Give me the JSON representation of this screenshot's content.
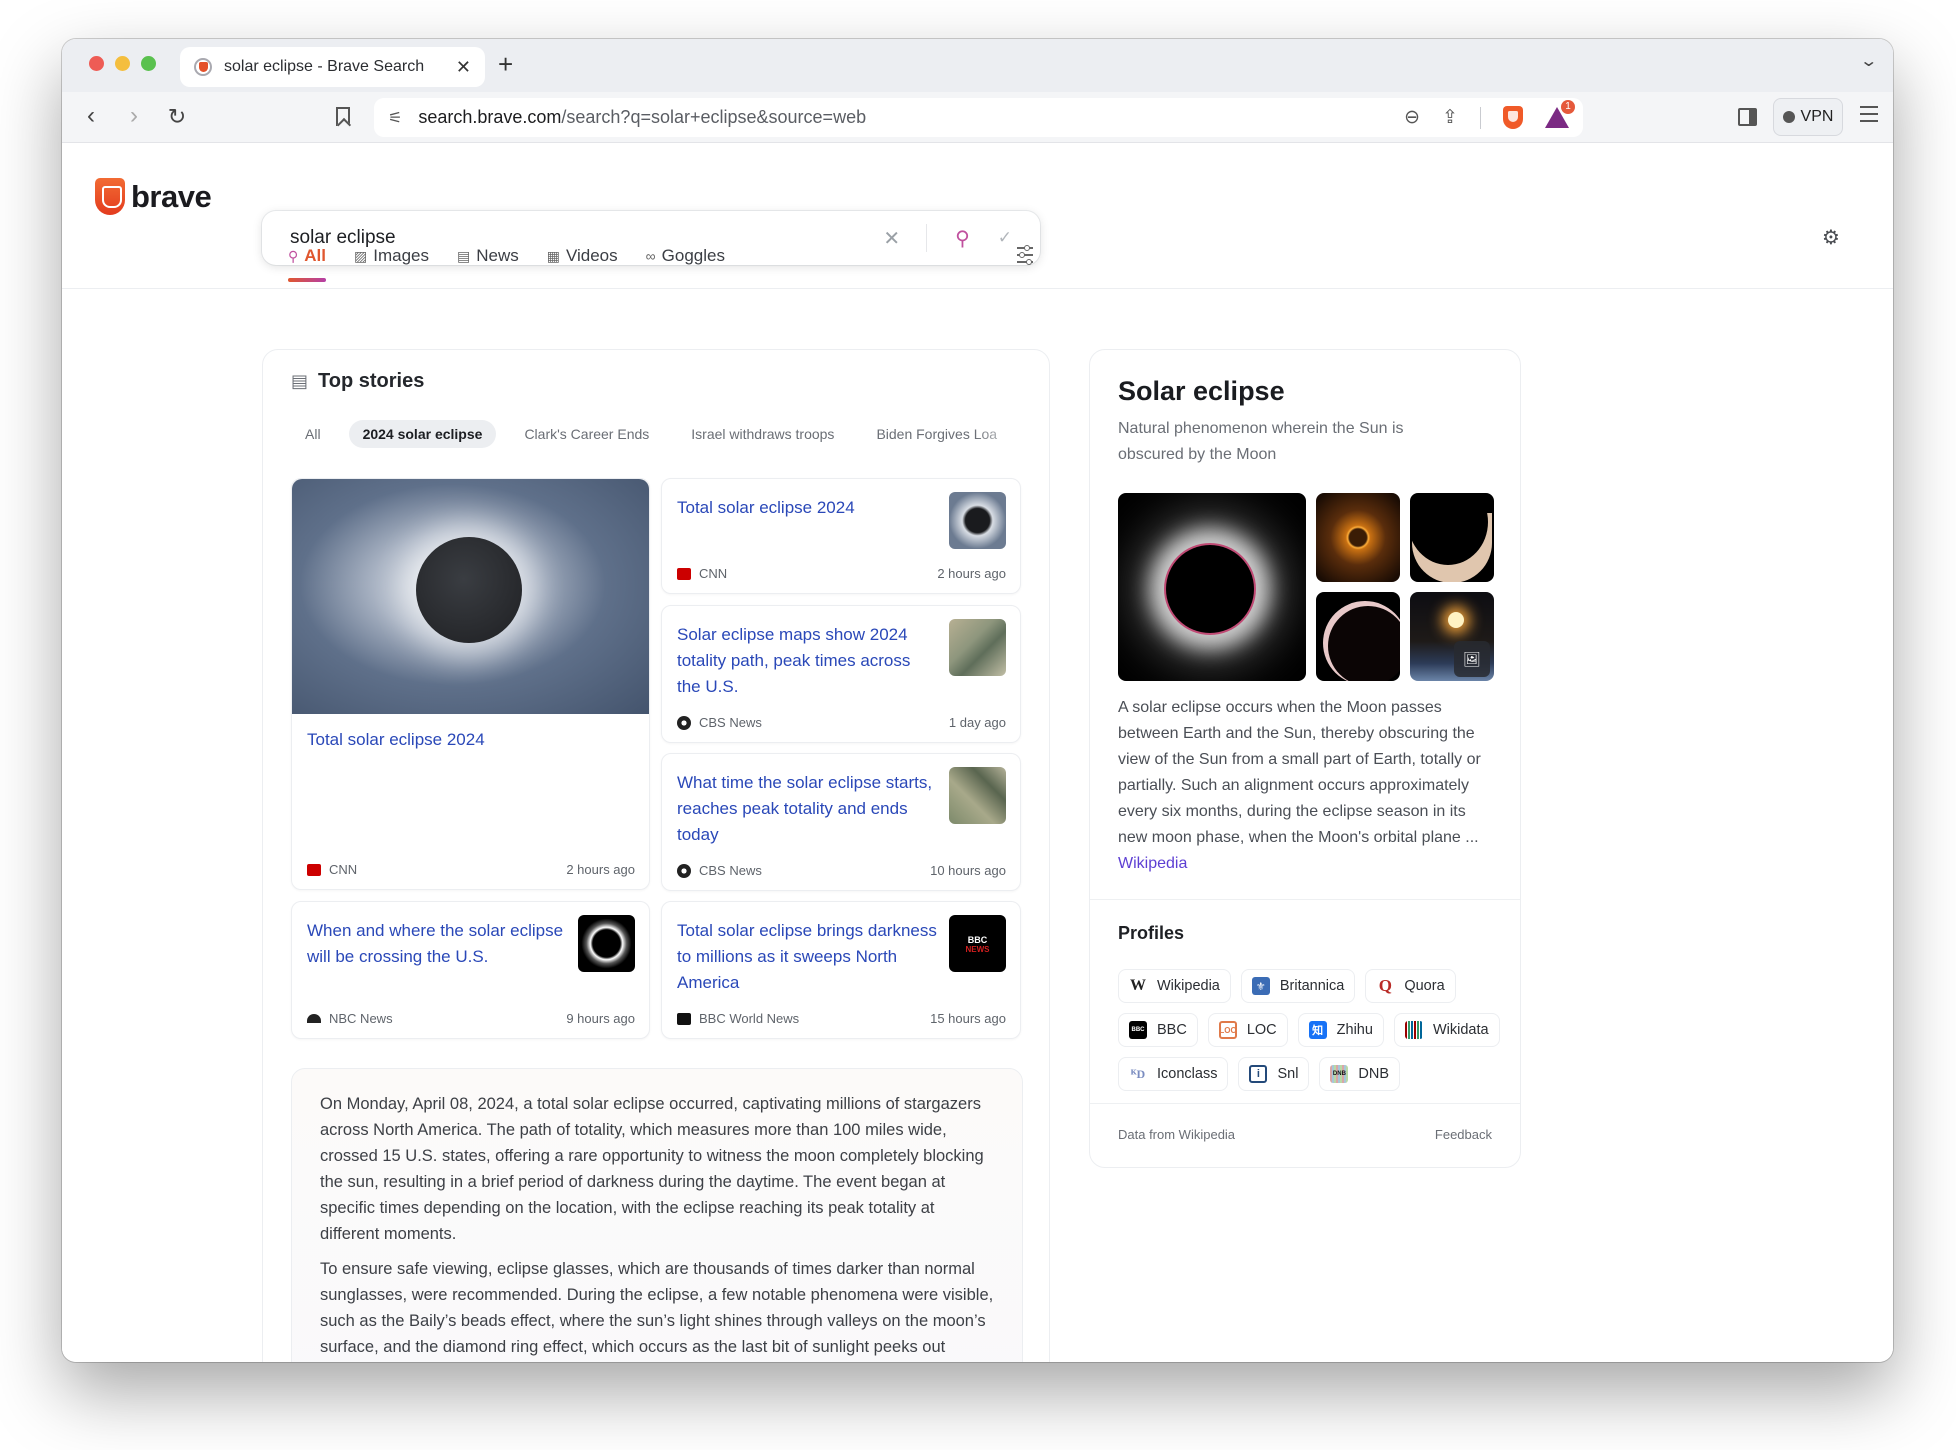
{
  "browser": {
    "tab_title": "solar eclipse - Brave Search",
    "tab_close": "✕",
    "new_tab": "+",
    "tab_menu": "⌄",
    "url_host": "search.brave.com",
    "url_rest": "/search?q=solar+eclipse&source=web",
    "vpn_label": "VPN",
    "rewards_badge": "1"
  },
  "search": {
    "logo_text": "brave",
    "query": "solar eclipse",
    "clear_icon": "✕",
    "search_icon": "⚲",
    "check_icon": "✓",
    "settings_icon": "⚙"
  },
  "nav_tabs": [
    {
      "label": "All",
      "icon": "⚲",
      "active": true
    },
    {
      "label": "Images",
      "icon": "▨"
    },
    {
      "label": "News",
      "icon": "▤"
    },
    {
      "label": "Videos",
      "icon": "▦"
    },
    {
      "label": "Goggles",
      "icon": "∞"
    }
  ],
  "top_stories": {
    "title": "Top stories",
    "chips": [
      "All",
      "2024 solar eclipse",
      "Clark's Career Ends",
      "Israel withdraws troops",
      "Biden Forgives Loa"
    ],
    "active_chip": "2024 solar eclipse",
    "featured": {
      "headline": "Total solar eclipse 2024",
      "source": "CNN",
      "time": "2 hours ago"
    },
    "cards": [
      {
        "headline": "Total solar eclipse 2024",
        "source": "CNN",
        "time": "2 hours ago"
      },
      {
        "headline": "Solar eclipse maps show 2024 totality path, peak times across the U.S.",
        "source": "CBS News",
        "time": "1 day ago"
      },
      {
        "headline": "What time the solar eclipse starts, reaches peak totality and ends today",
        "source": "CBS News",
        "time": "10 hours ago"
      },
      {
        "headline": "When and where the solar eclipse will be crossing the U.S.",
        "source": "NBC News",
        "time": "9 hours ago"
      },
      {
        "headline": "Total solar eclipse brings darkness to millions as it sweeps North America",
        "source": "BBC World News",
        "time": "15 hours ago",
        "thumb_text": "BBC",
        "thumb_sub": "NEWS"
      }
    ],
    "summary": [
      "On Monday, April 08, 2024, a total solar eclipse occurred, captivating millions of stargazers across North America. The path of totality, which measures more than 100 miles wide, crossed 15 U.S. states, offering a rare opportunity to witness the moon completely blocking the sun, resulting in a brief period of darkness during the daytime. The event began at specific times depending on the location, with the eclipse reaching its peak totality at different moments.",
      "To ensure safe viewing, eclipse glasses, which are thousands of times darker than normal sunglasses, were recommended. During the eclipse, a few notable phenomena were visible, such as the Baily’s beads effect, where the sun’s light shines through valleys on the moon’s surface, and the diamond ring effect, which occurs as the last bit of sunlight peeks out before and after totality."
    ]
  },
  "knowledge_panel": {
    "title": "Solar eclipse",
    "subtitle": "Natural phenomenon wherein the Sun is obscured by the Moon",
    "description": "A solar eclipse occurs when the Moon passes between Earth and the Sun, thereby obscuring the view of the Sun from a small part of Earth, totally or partially. Such an alignment occurs approximately every six months, during the eclipse season in its new moon phase, when the Moon's orbital plane ...",
    "source_link": "Wikipedia",
    "gallery_more_icon": "🖼",
    "profiles_title": "Profiles",
    "profiles": [
      {
        "label": "Wikipedia",
        "icon": "W",
        "cls": "wiki"
      },
      {
        "label": "Britannica",
        "icon": "⚜",
        "cls": "brit"
      },
      {
        "label": "Quora",
        "icon": "Q",
        "cls": "quora"
      },
      {
        "label": "BBC",
        "icon": "BBC",
        "cls": "bbc"
      },
      {
        "label": "LOC",
        "icon": "LOC",
        "cls": "loc"
      },
      {
        "label": "Zhihu",
        "icon": "知",
        "cls": "zhihu"
      },
      {
        "label": "Wikidata",
        "icon": "",
        "cls": "wikidata"
      },
      {
        "label": "Iconclass",
        "icon": "ᴷD",
        "cls": "iconclass"
      },
      {
        "label": "Snl",
        "icon": "i",
        "cls": "snl"
      },
      {
        "label": "DNB",
        "icon": "DNB",
        "cls": "dnb"
      }
    ],
    "footer_left": "Data from Wikipedia",
    "footer_right": "Feedback"
  }
}
